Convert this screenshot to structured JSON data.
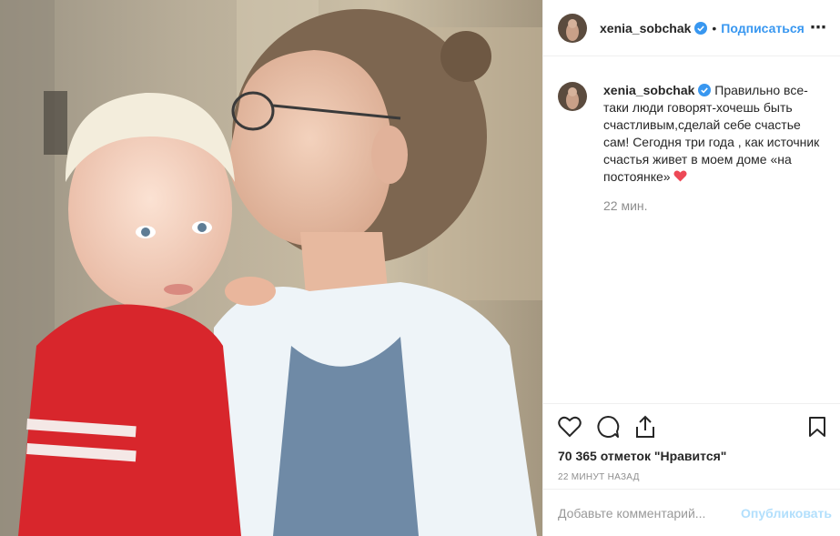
{
  "post": {
    "username": "xenia_sobchak",
    "follow_label": "Подписаться",
    "dot": "•",
    "more_label": "⋯",
    "caption_text": "Правильно все-таки люди говорят-хочешь быть счастливым,сделай себе счастье сам! Сегодня три года , как источник счастья живет в моем доме «на постоянке»",
    "caption_time": "22 мин.",
    "likes": "70 365 отметок \"Нравится\"",
    "timestamp": "22 МИНУТ НАЗАД",
    "comment_placeholder": "Добавьте комментарий...",
    "publish_label": "Опубликовать"
  },
  "icons": {
    "verified": "verified-badge-icon",
    "heart_emoji": "red-heart-emoji",
    "like": "heart-outline-icon",
    "comment": "speech-bubble-icon",
    "share": "share-upload-icon",
    "save": "bookmark-icon",
    "more": "more-dots-icon"
  },
  "colors": {
    "accent": "#3897f0",
    "publish_disabled": "#b2dffc",
    "muted": "#8e8e8e",
    "text": "#262626",
    "heart": "#ed4956"
  }
}
